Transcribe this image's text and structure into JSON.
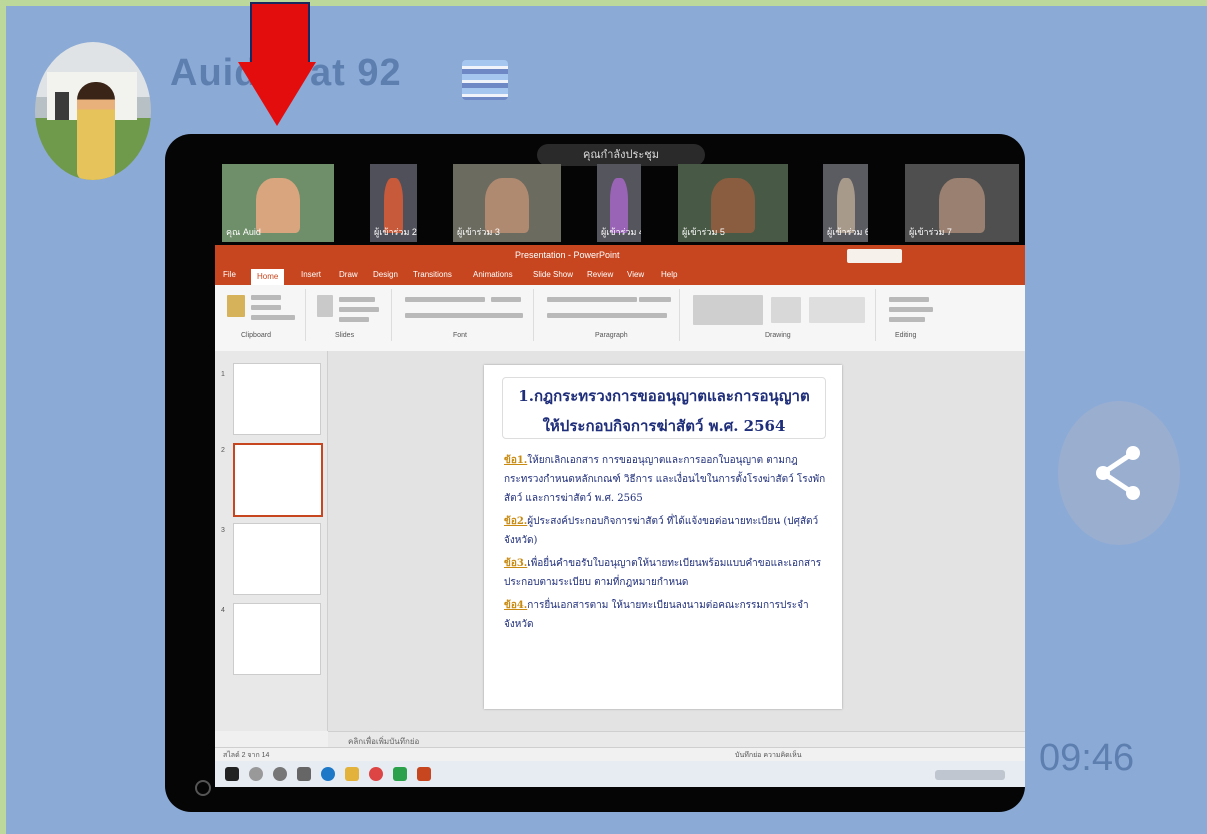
{
  "message": {
    "sender": "Auid  hrat 92",
    "time": "09:46"
  },
  "meeting": {
    "title": "คุณกำลังประชุม",
    "participants": [
      {
        "name": "คุณ Auid",
        "bg": "#6f8f6a",
        "face": "#d9a57e"
      },
      {
        "name": "ผู้เข้าร่วม 2",
        "bg": "#50505a",
        "face": "#c65a3a"
      },
      {
        "name": "ผู้เข้าร่วม 3",
        "bg": "#6b6b60",
        "face": "#b08a70"
      },
      {
        "name": "ผู้เข้าร่วม 4",
        "bg": "#55555e",
        "face": "#9a64b6"
      },
      {
        "name": "ผู้เข้าร่วม 5",
        "bg": "#485a45",
        "face": "#8a5d40"
      },
      {
        "name": "ผู้เข้าร่วม 6",
        "bg": "#5b5b62",
        "face": "#a89a8a"
      },
      {
        "name": "ผู้เข้าร่วม 7",
        "bg": "#4f4f4f",
        "face": "#9a8070"
      }
    ]
  },
  "powerpoint": {
    "doc_title": "Presentation - PowerPoint",
    "tabs": [
      "File",
      "Home",
      "Insert",
      "Draw",
      "Design",
      "Transitions",
      "Animations",
      "Slide Show",
      "Review",
      "View",
      "Help"
    ],
    "ribbon_groups": [
      "Clipboard",
      "Slides",
      "Font",
      "Paragraph",
      "Drawing",
      "Editing"
    ],
    "slide": {
      "title_line1": "1.กฎกระทรวงการขออนุญาตและการอนุญาต",
      "title_line2": "ให้ประกอบกิจการฆ่าสัตว์ พ.ศ. 2564",
      "items": [
        {
          "num": "ข้อ1.",
          "text": "ให้ยกเลิกเอกสาร การขออนุญาตและการออกใบอนุญาต ตามกฎกระทรวงกำหนดหลักเกณฑ์ วิธีการ และเงื่อนไขในการตั้งโรงฆ่าสัตว์ โรงพักสัตว์ และการฆ่าสัตว์ พ.ศ. 2565"
        },
        {
          "num": "ข้อ2.",
          "text": "ผู้ประสงค์ประกอบกิจการฆ่าสัตว์ ที่ได้แจ้งขอต่อนายทะเบียน (ปศุสัตว์จังหวัด)"
        },
        {
          "num": "ข้อ3.",
          "text": "เพื่อยื่นคำขอรับใบอนุญาตให้นายทะเบียนพร้อมแบบคำขอและเอกสารประกอบตามระเบียบ ตามที่กฎหมายกำหนด"
        },
        {
          "num": "ข้อ4.",
          "text": "การยื่นเอกสารตาม ให้นายทะเบียนลงนามต่อคณะกรรมการประจำจังหวัด"
        }
      ]
    },
    "notes_placeholder": "คลิกเพื่อเพิ่มบันทึกย่อ",
    "status_left": "สไลด์ 2 จาก 14",
    "status_right": "บันทึกย่อ   ความคิดเห็น"
  },
  "colors": {
    "chat_bg": "#8caad6",
    "ppt_accent": "#c8461f",
    "arrow": "#e30d0d"
  },
  "icons": [
    "red-down-arrow",
    "share-icon",
    "flag-icon"
  ]
}
